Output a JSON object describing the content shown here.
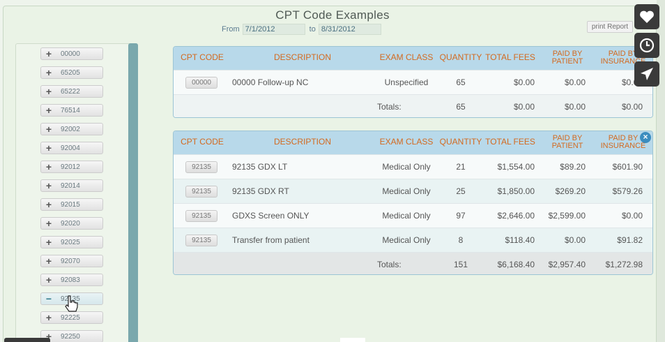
{
  "report": {
    "title": "CPT Code Examples",
    "from_label": "From",
    "from_value": "7/1/2012",
    "to_label": "to",
    "to_value": "8/31/2012",
    "print_label": "print Report"
  },
  "code_list": {
    "items": [
      {
        "sign": "+",
        "code": "00000"
      },
      {
        "sign": "+",
        "code": "65205"
      },
      {
        "sign": "+",
        "code": "65222"
      },
      {
        "sign": "+",
        "code": "76514"
      },
      {
        "sign": "+",
        "code": "92002"
      },
      {
        "sign": "+",
        "code": "92004"
      },
      {
        "sign": "+",
        "code": "92012"
      },
      {
        "sign": "+",
        "code": "92014"
      },
      {
        "sign": "+",
        "code": "92015"
      },
      {
        "sign": "+",
        "code": "92020"
      },
      {
        "sign": "+",
        "code": "92025"
      },
      {
        "sign": "+",
        "code": "92070"
      },
      {
        "sign": "+",
        "code": "92083"
      },
      {
        "sign": "−",
        "code": "92135"
      },
      {
        "sign": "+",
        "code": "92225"
      },
      {
        "sign": "+",
        "code": "92250"
      }
    ]
  },
  "columns": {
    "cpt": "CPT CODE",
    "desc": "DESCRIPTION",
    "exam": "EXAM CLASS",
    "qty": "QUANTITY",
    "fees": "TOTAL FEES",
    "patient": "PAID BY PATIENT",
    "insurance": "PAID BY INSURANCE"
  },
  "table1": {
    "rows": [
      {
        "code": "00000",
        "desc": "00000 Follow-up NC",
        "exam": "Unspecified",
        "qty": "65",
        "fees": "$0.00",
        "patient": "$0.00",
        "insurance": "$0.00"
      }
    ],
    "totals": {
      "label": "Totals:",
      "qty": "65",
      "fees": "$0.00",
      "patient": "$0.00",
      "insurance": "$0.00"
    }
  },
  "table2": {
    "rows": [
      {
        "code": "92135",
        "desc": "92135 GDX LT",
        "exam": "Medical Only",
        "qty": "21",
        "fees": "$1,554.00",
        "patient": "$89.20",
        "insurance": "$601.90"
      },
      {
        "code": "92135",
        "desc": "92135 GDX RT",
        "exam": "Medical Only",
        "qty": "25",
        "fees": "$1,850.00",
        "patient": "$269.20",
        "insurance": "$579.26"
      },
      {
        "code": "92135",
        "desc": "GDXS Screen ONLY",
        "exam": "Medical Only",
        "qty": "97",
        "fees": "$2,646.00",
        "patient": "$2,599.00",
        "insurance": "$0.00"
      },
      {
        "code": "92135",
        "desc": "Transfer from patient",
        "exam": "Medical Only",
        "qty": "8",
        "fees": "$118.40",
        "patient": "$0.00",
        "insurance": "$91.82"
      }
    ],
    "totals": {
      "label": "Totals:",
      "qty": "151",
      "fees": "$6,168.40",
      "patient": "$2,957.40",
      "insurance": "$1,272.98"
    }
  },
  "colors": {
    "header_bg": "#b8d9ea",
    "header_text": "#d36a20",
    "accent": "#3b8dbf"
  },
  "icons": {
    "side": [
      "heart-icon",
      "clock-icon",
      "send-icon"
    ],
    "close": "close-icon",
    "close_glyph": "×"
  }
}
